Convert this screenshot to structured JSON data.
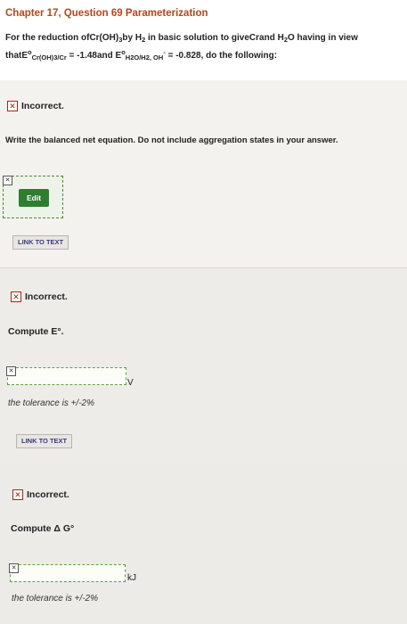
{
  "header": {
    "title": "Chapter 17, Question 69 Parameterization",
    "problem_line1": "For the reduction ofCr(OH)",
    "problem_l1_sub1": "3",
    "problem_l1_mid": "by H",
    "problem_l1_sub2": "2",
    "problem_l1_mid2": " in basic solution to giveCrand H",
    "problem_l1_sub3": "2",
    "problem_l1_end": "O having in view",
    "problem_l2_a": "thatE",
    "problem_l2_sup1": "o",
    "problem_l2_sub1": "Cr(OH)",
    "problem_l2_sub1b": "3",
    "problem_l2_sub1c": "/Cr",
    "problem_l2_b": " = -1.48and E",
    "problem_l2_sup2": "o",
    "problem_l2_sub2": "H2O/H2, OH",
    "problem_l2_sup3": "-",
    "problem_l2_c": " = -0.828, do the following:"
  },
  "part1": {
    "status": "Incorrect.",
    "prompt": "Write the balanced net equation. Do not include aggregation states in your answer.",
    "edit_label": "Edit",
    "link_label": "LINK TO TEXT"
  },
  "part2": {
    "status": "Incorrect.",
    "prompt": "Compute E°.",
    "unit": "V",
    "tolerance": "the tolerance is +/-2%",
    "link_label": "LINK TO TEXT"
  },
  "part3": {
    "status": "Incorrect.",
    "prompt": "Compute  Δ G°",
    "unit": "kJ",
    "tolerance": "the tolerance is +/-2%"
  },
  "icons": {
    "incorrect": "✕",
    "small_x": "✕"
  }
}
